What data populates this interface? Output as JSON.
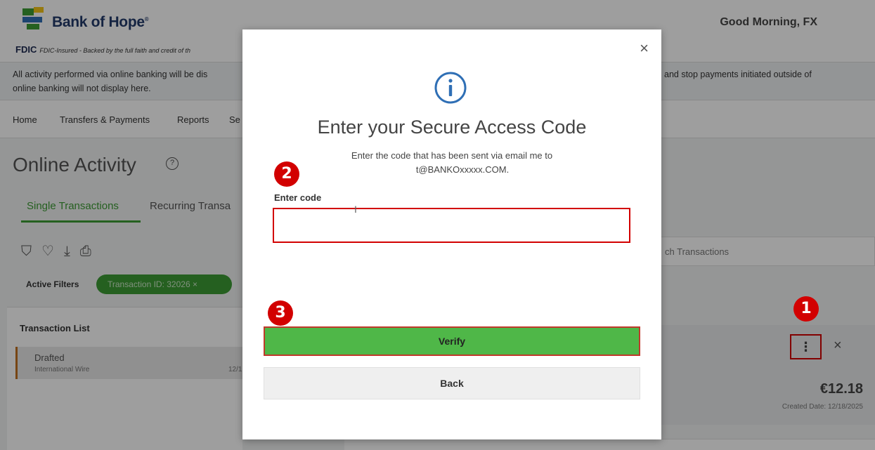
{
  "header": {
    "brand": "Bank of Hope",
    "fdic_label": "FDIC",
    "fdic_text": "FDIC-Insured - Backed by the full faith and credit of th",
    "greeting": "Good Morning, FX"
  },
  "notice": {
    "line1_left": "All activity performed via online banking will be dis",
    "line2_left": "online banking will not display here.",
    "line1_right": "and stop payments initiated outside of"
  },
  "nav": {
    "items": [
      "Home",
      "Transfers & Payments",
      "Reports",
      "Se"
    ]
  },
  "page": {
    "title": "Online Activity",
    "help_icon": "question-circle-icon",
    "tabs": [
      "Single Transactions",
      "Recurring Transa"
    ],
    "toolbar_icons": [
      "filter-icon",
      "heart-icon",
      "download-icon",
      "print-icon"
    ],
    "active_filters_label": "Active Filters",
    "filter_chip": "Transaction ID: 32026  ×",
    "list_title": "Transaction List",
    "row": {
      "status": "Drafted",
      "type": "International Wire",
      "date": "12/1",
      "amount_partial": "€"
    },
    "search_placeholder": "ch Transactions",
    "detail": {
      "menu_glyph": "⋮",
      "close_glyph": "×",
      "amount": "€12.18",
      "created": "Created Date: 12/18/2025"
    }
  },
  "badges": [
    "1",
    "2",
    "3"
  ],
  "modal": {
    "close_glyph": "×",
    "icon": "info-circle-icon",
    "title": "Enter your Secure Access Code",
    "sub_line1": "Enter the code that has been sent via email me to",
    "sub_line2": "t@BANKOxxxxx.COM.",
    "code_label": "Enter code",
    "code_value": "",
    "verify_label": "Verify",
    "back_label": "Back"
  },
  "colors": {
    "accent_green": "#3d9b35",
    "verify_green": "#4fb748",
    "annotation_red": "#d20000",
    "brand_navy": "#233a6b"
  }
}
